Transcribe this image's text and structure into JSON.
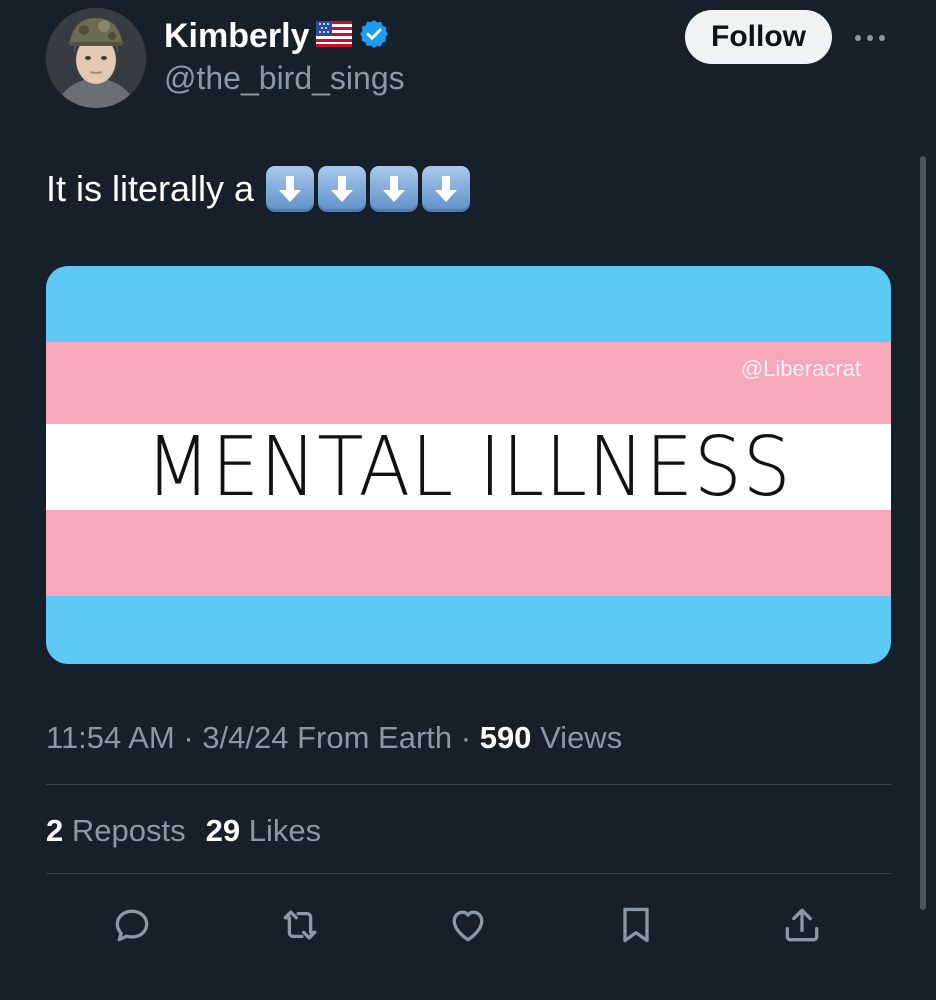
{
  "author": {
    "display_name": "Kimberly",
    "flag_icon": "us-flag-icon",
    "verified_icon": "verified-badge-icon",
    "handle": "@the_bird_sings",
    "avatar_icon": "user-avatar-photo"
  },
  "follow_label": "Follow",
  "more_icon": "more-options-icon",
  "text": "It is literally a",
  "emoji": [
    "down-arrow-icon",
    "down-arrow-icon",
    "down-arrow-icon",
    "down-arrow-icon"
  ],
  "media": {
    "watermark": "@Liberacrat",
    "caption": "MENTAL ILLNESS",
    "colors": {
      "blue": "#5fc9f5",
      "pink": "#f6a8b9",
      "white": "#ffffff"
    }
  },
  "meta": {
    "time": "11:54 AM",
    "sep": "·",
    "date": "3/4/24",
    "source": "From Earth",
    "views_count": "590",
    "views_label": "Views"
  },
  "stats": {
    "reposts_count": "2",
    "reposts_label": "Reposts",
    "likes_count": "29",
    "likes_label": "Likes"
  },
  "actions": [
    "reply-icon",
    "repost-icon",
    "like-icon",
    "bookmark-icon",
    "share-icon"
  ],
  "colors": {
    "background": "#15202b",
    "text_primary": "#ffffff",
    "text_secondary": "#8b98a5",
    "verified": "#1d9bf0",
    "divider": "#38444d"
  }
}
